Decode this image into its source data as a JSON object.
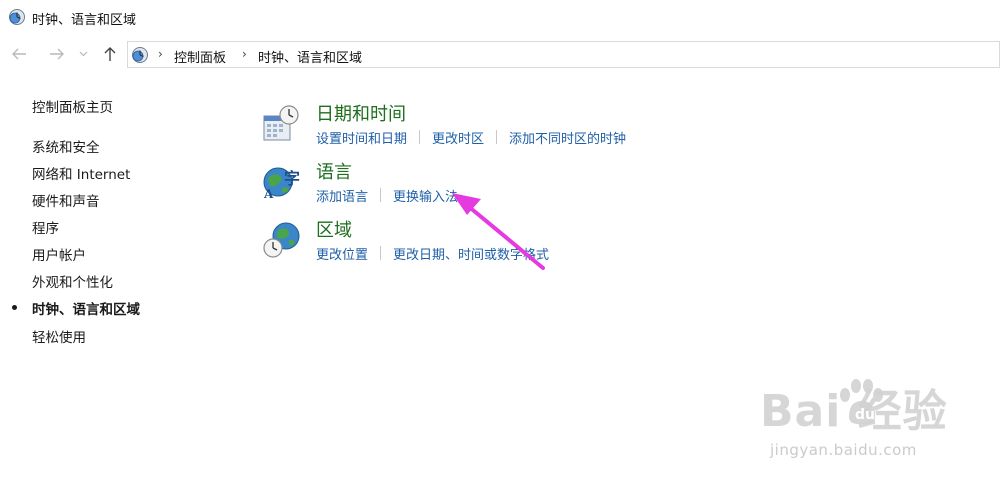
{
  "window": {
    "title": "时钟、语言和区域"
  },
  "address": {
    "crumbs": [
      "控制面板",
      "时钟、语言和区域"
    ]
  },
  "sidebar": {
    "home": "控制面板主页",
    "items": [
      {
        "label": "系统和安全"
      },
      {
        "label": "网络和 Internet"
      },
      {
        "label": "硬件和声音"
      },
      {
        "label": "程序"
      },
      {
        "label": "用户帐户"
      },
      {
        "label": "外观和个性化"
      },
      {
        "label": "时钟、语言和区域",
        "current": true
      },
      {
        "label": "轻松使用"
      }
    ]
  },
  "categories": [
    {
      "title": "日期和时间",
      "icon": "calendar-clock-icon",
      "links": [
        "设置时间和日期",
        "更改时区",
        "添加不同时区的时钟"
      ]
    },
    {
      "title": "语言",
      "icon": "language-globe-icon",
      "links": [
        "添加语言",
        "更换输入法"
      ]
    },
    {
      "title": "区域",
      "icon": "region-globe-clock-icon",
      "links": [
        "更改位置",
        "更改日期、时间或数字格式"
      ]
    }
  ],
  "annotation": {
    "color": "#e43adf"
  },
  "watermark": {
    "logo": "Bai  经验",
    "url": "jingyan.baidu.com"
  },
  "colors": {
    "category_title": "#1e6e1e",
    "link": "#1f5fa8",
    "current_bullet": "#1a1a1a"
  }
}
